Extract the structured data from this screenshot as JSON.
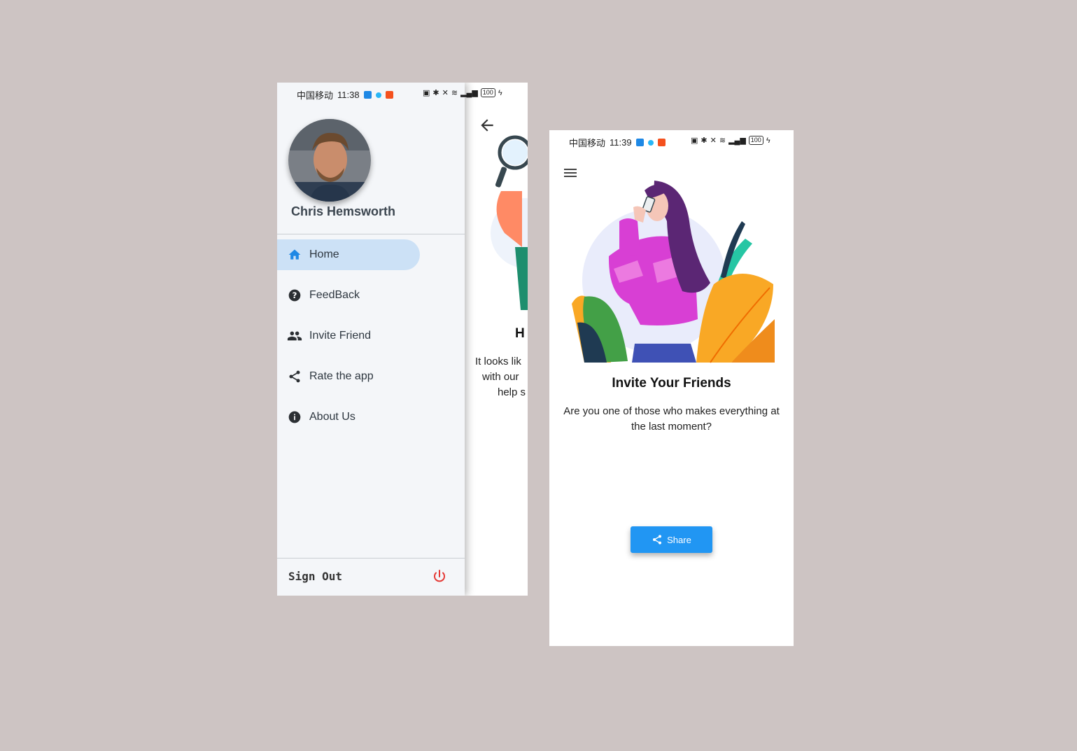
{
  "phone1": {
    "status": {
      "carrier": "中国移动",
      "time": "11:38",
      "battery": "100"
    },
    "back_page": {
      "title_fragment": "H",
      "text_lines": [
        "It looks lik",
        "with our",
        "help s"
      ]
    },
    "drawer": {
      "user_name": "Chris Hemsworth",
      "menu": [
        {
          "label": "Home",
          "icon": "home-icon",
          "active": true
        },
        {
          "label": "FeedBack",
          "icon": "help-circle-icon",
          "active": false
        },
        {
          "label": "Invite Friend",
          "icon": "people-icon",
          "active": false
        },
        {
          "label": "Rate the app",
          "icon": "share-icon",
          "active": false
        },
        {
          "label": "About Us",
          "icon": "info-icon",
          "active": false
        }
      ],
      "sign_out_label": "Sign Out"
    }
  },
  "phone2": {
    "status": {
      "carrier": "中国移动",
      "time": "11:39",
      "battery": "100"
    },
    "title": "Invite Your Friends",
    "description": "Are you one of those who makes everything at the last moment?",
    "share_label": "Share"
  },
  "colors": {
    "background": "#cdc4c3",
    "accent": "#2196f3",
    "active_item": "#cce1f6",
    "power_icon": "#e53935"
  }
}
